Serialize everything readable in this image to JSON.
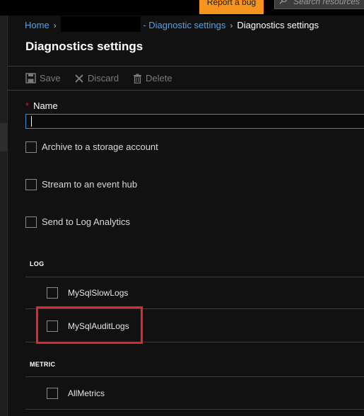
{
  "topbar": {
    "report_bug_label": "Report a bug",
    "search_placeholder": "Search resources"
  },
  "breadcrumb": {
    "home": "Home",
    "diag_link": "- Diagnostic settings",
    "current": "Diagnostics settings"
  },
  "page_title": "Diagnostics settings",
  "toolbar": {
    "save_label": "Save",
    "discard_label": "Discard",
    "delete_label": "Delete"
  },
  "form": {
    "name_label": "Name",
    "required_marker": "*",
    "name_value": "",
    "options": [
      {
        "label": "Archive to a storage account",
        "checked": false
      },
      {
        "label": "Stream to an event hub",
        "checked": false
      },
      {
        "label": "Send to Log Analytics",
        "checked": false
      }
    ]
  },
  "log_section": {
    "header": "LOG",
    "items": [
      {
        "label": "MySqlSlowLogs",
        "checked": false
      },
      {
        "label": "MySqlAuditLogs",
        "checked": false
      }
    ]
  },
  "metric_section": {
    "header": "METRIC",
    "items": [
      {
        "label": "AllMetrics",
        "checked": false
      }
    ]
  },
  "colors": {
    "accent_link": "#4aa4f1",
    "report_bug_bg": "#f7941d",
    "input_focus_border": "#2f8ed5",
    "highlight_box": "#e0272f",
    "required_star": "#e81123"
  }
}
